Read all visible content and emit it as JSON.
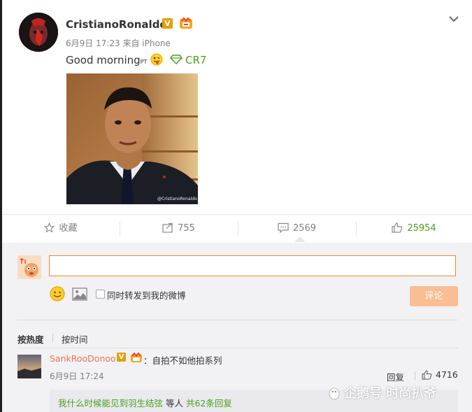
{
  "post": {
    "username": "CristianoRonaldo",
    "verified_badge": "V",
    "meta": "6月9日 17:23 来自 iPhone",
    "text": "Good morning",
    "text_sub": "PT",
    "topic": "CR7",
    "photo_watermark": "@CristianoRonaldo"
  },
  "actions": {
    "favorite": "收藏",
    "reposts": "755",
    "comments": "2569",
    "likes": "25954"
  },
  "comment_box": {
    "input_value": "",
    "repost_label": "同时转发到我的微博",
    "submit": "评论"
  },
  "sort": {
    "hot": "按热度",
    "time": "按时间"
  },
  "comment": {
    "user": "SankRooDonoo",
    "verified_badge": "V",
    "text": "：自拍不如他拍系列",
    "time": "6月9日 17:24",
    "reply": "回复",
    "likes": "4716"
  },
  "subreply": {
    "link_text": "我什么时候能见到羽生结弦",
    "middle": " 等人 ",
    "count_link": "共62条回复"
  },
  "watermark": "企鹅号 时尚扒爷",
  "colors": {
    "accent_orange": "#eb7350",
    "green": "#4b9f1c",
    "submit_bg": "#fbbd94",
    "panel_bg": "#f2f2f5"
  }
}
